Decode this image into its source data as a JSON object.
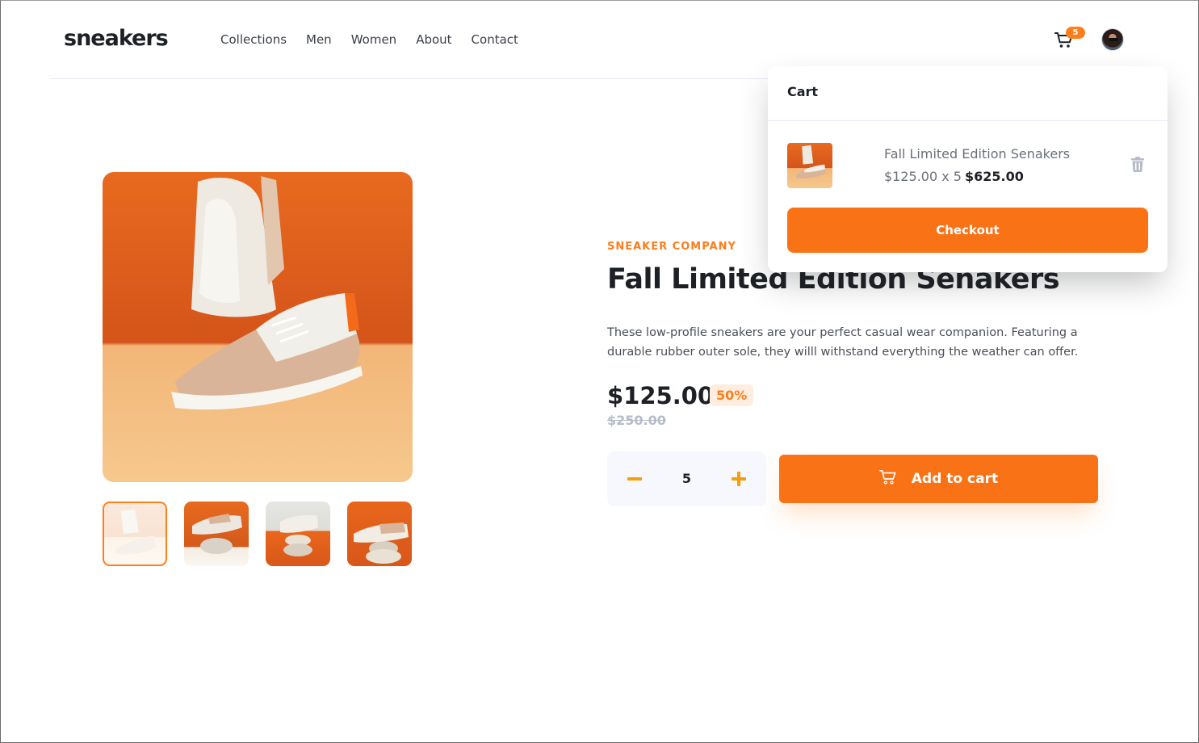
{
  "header": {
    "logo": "sneakers",
    "nav": [
      "Collections",
      "Men",
      "Women",
      "About",
      "Contact"
    ],
    "cart_count": "5"
  },
  "product": {
    "company": "SNEAKER COMPANY",
    "title": "Fall Limited Edition Senakers",
    "description": "These low-profile sneakers are your perfect casual wear companion. Featuring a durable rubber outer sole, they willl withstand everything the weather can offer.",
    "price": "$125.00",
    "discount": "50%",
    "old_price": "$250.00",
    "quantity": "5",
    "add_to_cart_label": "Add to cart"
  },
  "cart": {
    "title": "Cart",
    "item_name": "Fall Limited Edition Senakers",
    "item_price_qty": "$125.00 x 5",
    "item_total": "$625.00",
    "checkout_label": "Checkout"
  },
  "colors": {
    "accent": "#ff7e1b",
    "text_dark": "#1d2025"
  }
}
